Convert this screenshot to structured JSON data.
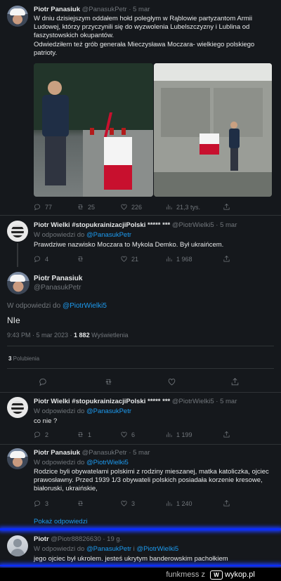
{
  "colors": {
    "bg": "#15181c",
    "link": "#1d9bf0",
    "muted": "#71767b",
    "glow": "#1c3dff"
  },
  "post1": {
    "name": "Piotr Panasiuk",
    "meta": "@PanasukPetr · 5 mar",
    "text": "W dniu dzisiejszym oddałem hołd poległym w Rąblowie partyzantom Armii Ludowej, którzy przyczynili się do wyzwolenia Lubelszczyzny i  Lublina od faszystowskich okupantów.\nOdwiedziłem też grób generała Mieczysława Moczara- wielkiego polskiego patrioty.",
    "replies": "77",
    "retweets": "25",
    "likes": "226",
    "views": "21,3 tys."
  },
  "post2": {
    "name": "Piotr Wielki #stopukrainizacjiPolski ***** ***",
    "meta": "@PiotrWielki5 · 5 mar",
    "reply_prefix": "W odpowiedzi do ",
    "reply_to": "@PanasukPetr",
    "text": "Prawdziwe nazwisko Moczara to Mykola Demko. Był ukraińcem.",
    "replies": "4",
    "retweets": "",
    "likes": "21",
    "views": "1 968"
  },
  "main": {
    "name": "Piotr Panasiuk",
    "handle": "@PanasukPetr",
    "reply_prefix": "W odpowiedzi do ",
    "reply_to": "@PiotrWielki5",
    "text": "NIe",
    "time": "9:43 PM · 5 mar 2023 · ",
    "views_count": "1 882",
    "views_label": " Wyświetlenia",
    "likes_count": "3",
    "likes_label": " Polubienia"
  },
  "post3": {
    "name": "Piotr Wielki #stopukrainizacjiPolski ***** ***",
    "meta": "@PiotrWielki5 · 5 mar",
    "reply_prefix": "W odpowiedzi do ",
    "reply_to": "@PanasukPetr",
    "text": "co nie ?",
    "replies": "2",
    "retweets": "1",
    "likes": "6",
    "views": "1 199"
  },
  "post4": {
    "name": "Piotr Panasiuk",
    "meta": "@PanasukPetr · 5 mar",
    "reply_prefix": "W odpowiedzi do ",
    "reply_to": "@PiotrWielki5",
    "text": "Rodzice byli obywatelami polskimi z rodziny mieszanej, matka katoliczka, ojciec prawosławny. Przed 1939 1/3 obywateli polskich posiadała korzenie kresowe, białoruski, ukraińskie,",
    "replies": "3",
    "retweets": "",
    "likes": "3",
    "views": "1 240"
  },
  "show_replies": "Pokaż odpowiedzi",
  "post5": {
    "name": "Piotr",
    "meta": "@Piotr88826630 · 19 g.",
    "reply_prefix": "W odpowiedzi do ",
    "reply_to_1": "@PanasukPetr",
    "reply_join": " i ",
    "reply_to_2": "@PiotrWielki5",
    "text": "jego ojciec był ukrolem. jesteś ukrytym banderowskim pachołkiem"
  },
  "footer": {
    "source": "funkmess z",
    "brand": "wykop.pl"
  }
}
